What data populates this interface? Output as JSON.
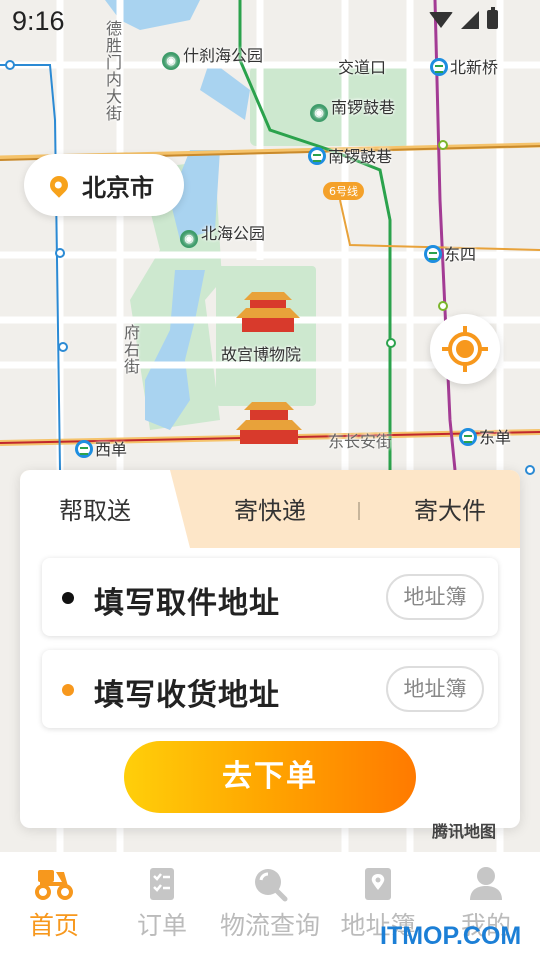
{
  "status_bar": {
    "time": "9:16"
  },
  "map": {
    "labels": {
      "shichahai": "什刹海公园",
      "jiaodaokou": "交道口",
      "beixinqiao": "北新桥",
      "nanluoguxiang_park": "南锣鼓巷",
      "nanluoguxiang_station": "南锣鼓巷",
      "line6": "6号线",
      "beihai": "北海公园",
      "dongsi": "东四",
      "palace_museum": "故宫博物院",
      "xidan": "西单",
      "dongchanganjie": "东长安街",
      "dongdan": "东单",
      "deshengmennei": "德胜门内大街",
      "fuyoujie": "府右街"
    }
  },
  "city_selector": {
    "city": "北京市",
    "icon": "location-pin-icon"
  },
  "locate_button": {
    "icon": "locate-icon"
  },
  "order_card": {
    "tabs": [
      {
        "label": "帮取送",
        "active": true
      },
      {
        "label": "寄快递",
        "active": false
      },
      {
        "label": "寄大件",
        "active": false
      }
    ],
    "pickup": {
      "placeholder": "填写取件地址",
      "book_label": "地址簿",
      "dot_color": "#111111"
    },
    "delivery": {
      "placeholder": "填写收货地址",
      "book_label": "地址簿",
      "dot_color": "#f7981d"
    },
    "submit_label": "去下单"
  },
  "map_attribution": "腾讯地图",
  "bottom_nav": {
    "items": [
      {
        "label": "首页",
        "icon": "scooter-icon",
        "active": true
      },
      {
        "label": "订单",
        "icon": "order-list-icon",
        "active": false
      },
      {
        "label": "物流查询",
        "icon": "search-icon",
        "active": false
      },
      {
        "label": "地址簿",
        "icon": "address-book-icon",
        "active": false
      },
      {
        "label": "我的",
        "icon": "user-icon",
        "active": false
      }
    ]
  },
  "watermark": "ITMOP.COM",
  "colors": {
    "accent": "#f7981d",
    "tab_bg": "#fde6c8",
    "active_nav": "#f7981d",
    "inactive_nav": "#bbbbbb"
  }
}
